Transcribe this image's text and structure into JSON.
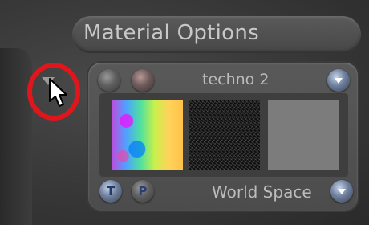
{
  "header": {
    "title": "Material Options"
  },
  "panel": {
    "top_label": "techno 2",
    "bottom_label": "World Space",
    "buttons": {
      "t_glyph": "T",
      "p_glyph": "P"
    }
  },
  "colors": {
    "highlight": "#e0161c",
    "accent_button": "#6d7f9d"
  },
  "icons": [
    "dropdown-triangle-icon",
    "cursor-arrow-icon",
    "round-button-icon"
  ]
}
